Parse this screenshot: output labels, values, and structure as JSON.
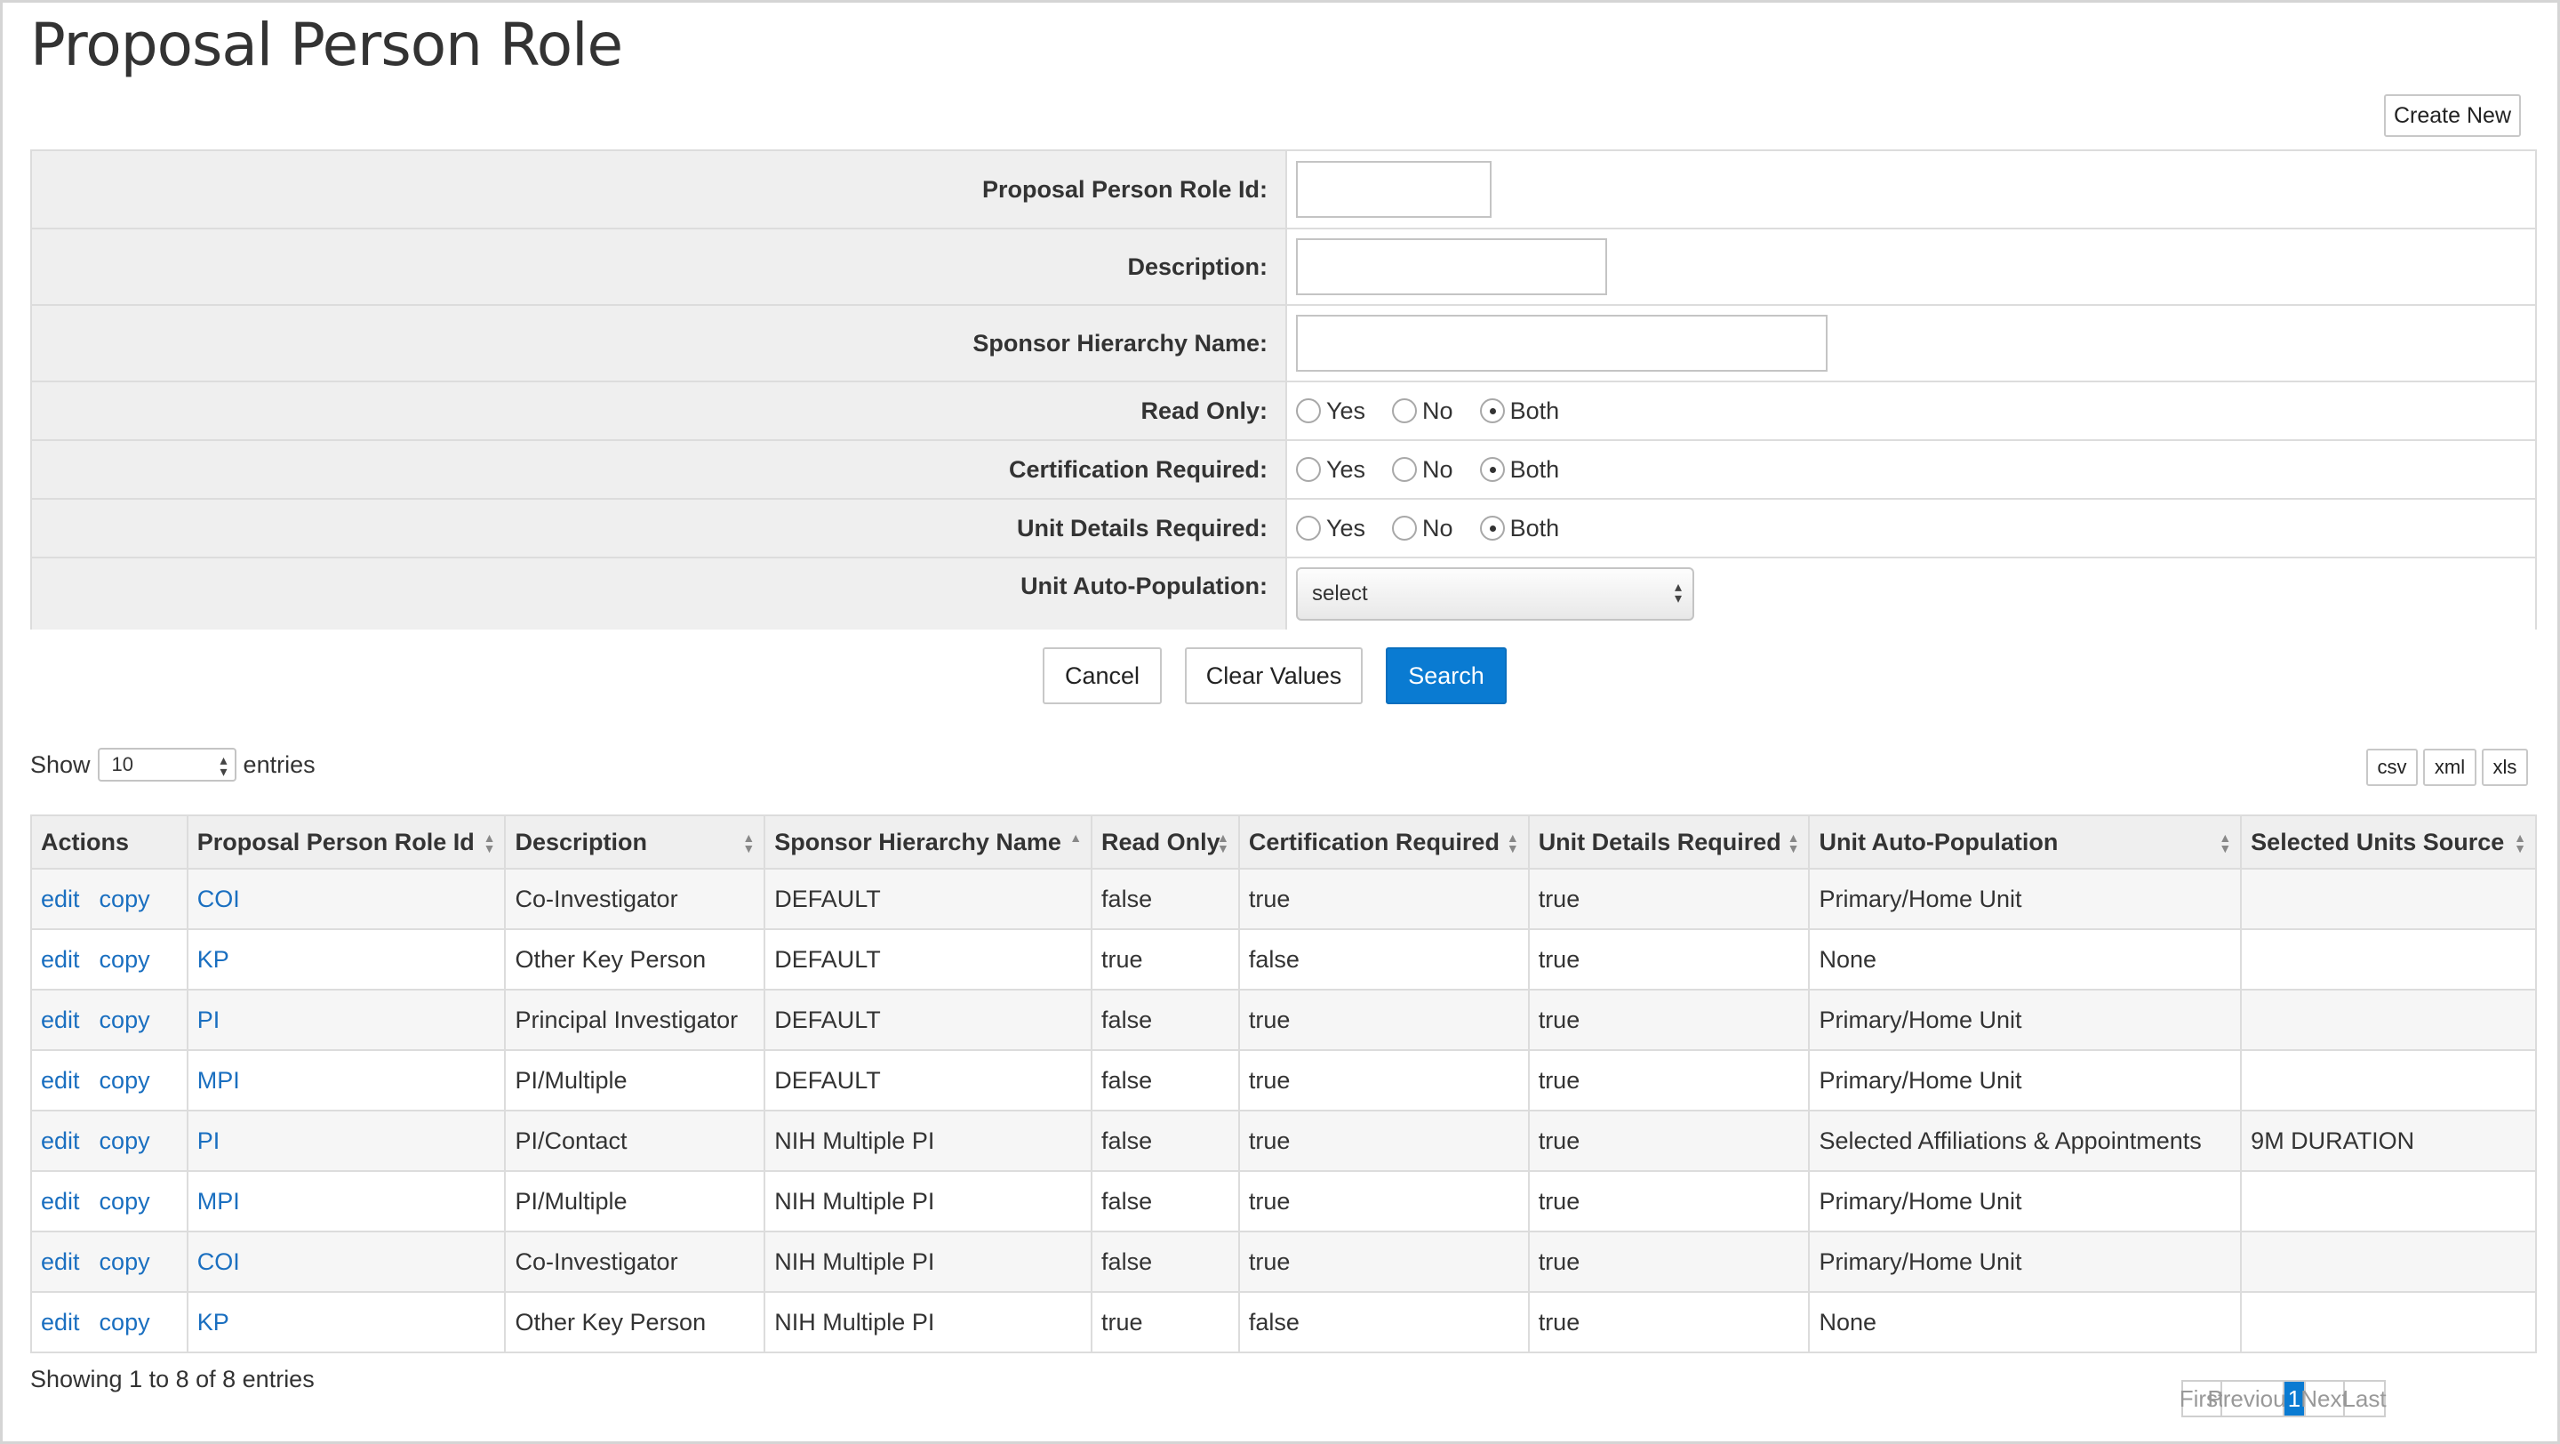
{
  "page": {
    "title": "Proposal Person Role",
    "create_new_label": "Create New"
  },
  "criteria": {
    "role_id_label": "Proposal Person Role Id:",
    "role_id_value": "",
    "description_label": "Description:",
    "description_value": "",
    "sponsor_label": "Sponsor Hierarchy Name:",
    "sponsor_value": "",
    "read_only": {
      "label": "Read Only:",
      "options": [
        "Yes",
        "No",
        "Both"
      ],
      "selected": "Both"
    },
    "certification": {
      "label": "Certification Required:",
      "options": [
        "Yes",
        "No",
        "Both"
      ],
      "selected": "Both"
    },
    "unit_details": {
      "label": "Unit Details Required:",
      "options": [
        "Yes",
        "No",
        "Both"
      ],
      "selected": "Both"
    },
    "unit_auto": {
      "label": "Unit Auto-Population:",
      "value": "select"
    }
  },
  "buttons": {
    "cancel": "Cancel",
    "clear": "Clear Values",
    "search": "Search"
  },
  "length_menu": {
    "show": "Show",
    "value": "10",
    "entries": "entries"
  },
  "export": {
    "csv": "csv",
    "xml": "xml",
    "xls": "xls"
  },
  "table": {
    "columns": [
      "Actions",
      "Proposal Person Role Id",
      "Description",
      "Sponsor Hierarchy Name",
      "Read Only",
      "Certification Required",
      "Unit Details Required",
      "Unit Auto-Population",
      "Selected Units Source"
    ],
    "actions": {
      "edit": "edit",
      "copy": "copy"
    },
    "rows": [
      [
        "COI",
        "Co-Investigator",
        "DEFAULT",
        "false",
        "true",
        "true",
        "Primary/Home Unit",
        ""
      ],
      [
        "KP",
        "Other Key Person",
        "DEFAULT",
        "true",
        "false",
        "true",
        "None",
        ""
      ],
      [
        "PI",
        "Principal Investigator",
        "DEFAULT",
        "false",
        "true",
        "true",
        "Primary/Home Unit",
        ""
      ],
      [
        "MPI",
        "PI/Multiple",
        "DEFAULT",
        "false",
        "true",
        "true",
        "Primary/Home Unit",
        ""
      ],
      [
        "PI",
        "PI/Contact",
        "NIH Multiple PI",
        "false",
        "true",
        "true",
        "Selected Affiliations & Appointments",
        "9M DURATION"
      ],
      [
        "MPI",
        "PI/Multiple",
        "NIH Multiple PI",
        "false",
        "true",
        "true",
        "Primary/Home Unit",
        ""
      ],
      [
        "COI",
        "Co-Investigator",
        "NIH Multiple PI",
        "false",
        "true",
        "true",
        "Primary/Home Unit",
        ""
      ],
      [
        "KP",
        "Other Key Person",
        "NIH Multiple PI",
        "true",
        "false",
        "true",
        "None",
        ""
      ]
    ]
  },
  "footer": {
    "info": "Showing 1 to 8 of 8 entries",
    "pager": {
      "first": "First",
      "previous": "Previous",
      "current": "1",
      "next": "Next",
      "last": "Last"
    }
  }
}
